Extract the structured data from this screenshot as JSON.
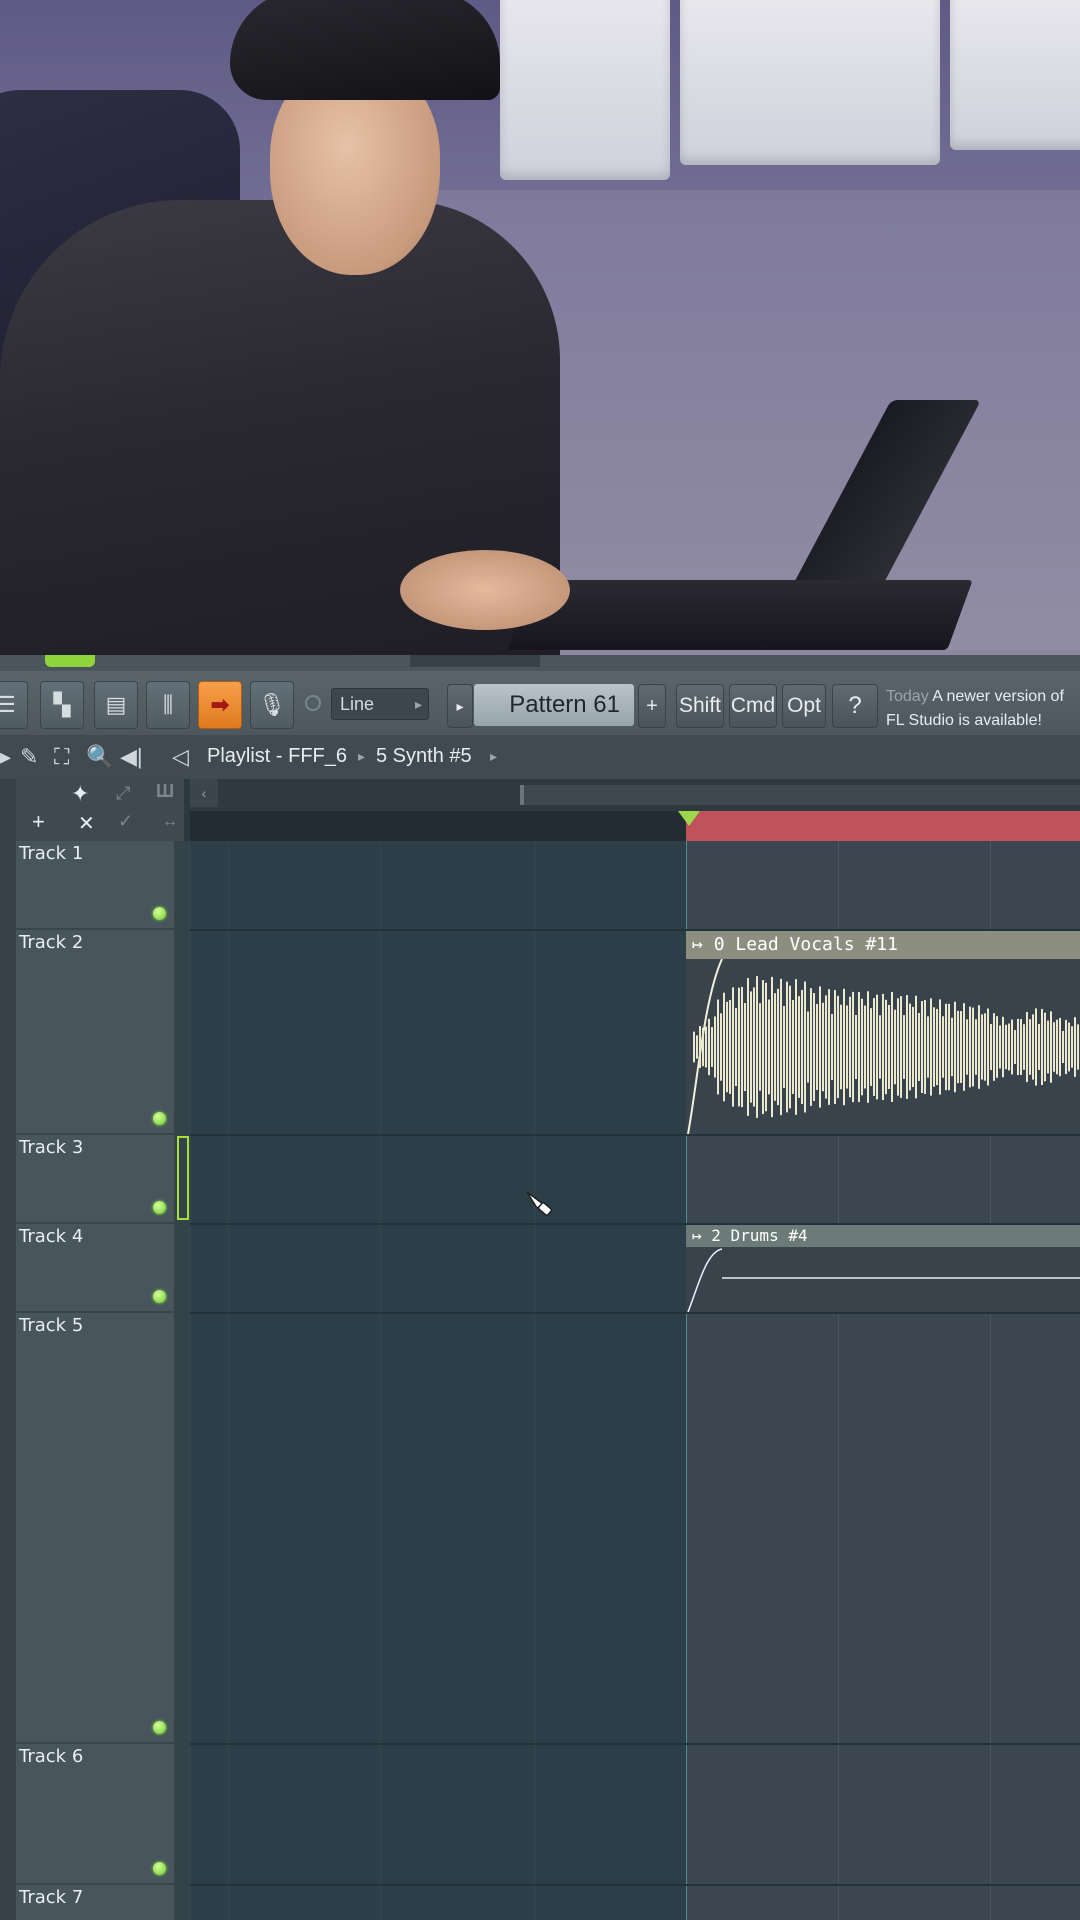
{
  "toolbar": {
    "snap_value": "Line",
    "pattern_label": "Pattern 61",
    "modifier_keys": [
      "Shift",
      "Cmd",
      "Opt"
    ],
    "news_today": "Today",
    "news_text_1": "A newer version of",
    "news_text_2": "FL Studio is available!"
  },
  "playlist": {
    "title": "Playlist - FFF_6",
    "pattern": "5 Synth #5"
  },
  "tracks": [
    {
      "name": "Track 1"
    },
    {
      "name": "Track 2"
    },
    {
      "name": "Track 3"
    },
    {
      "name": "Track 4"
    },
    {
      "name": "Track 5"
    },
    {
      "name": "Track 6"
    },
    {
      "name": "Track 7"
    }
  ],
  "clips": {
    "vocals": "0 Lead Vocals #11",
    "drums": "2 Drums #4"
  },
  "colors": {
    "accent_orange": "#e8892c",
    "led_green": "#7ee03a",
    "ruler_red": "#c1525b"
  }
}
